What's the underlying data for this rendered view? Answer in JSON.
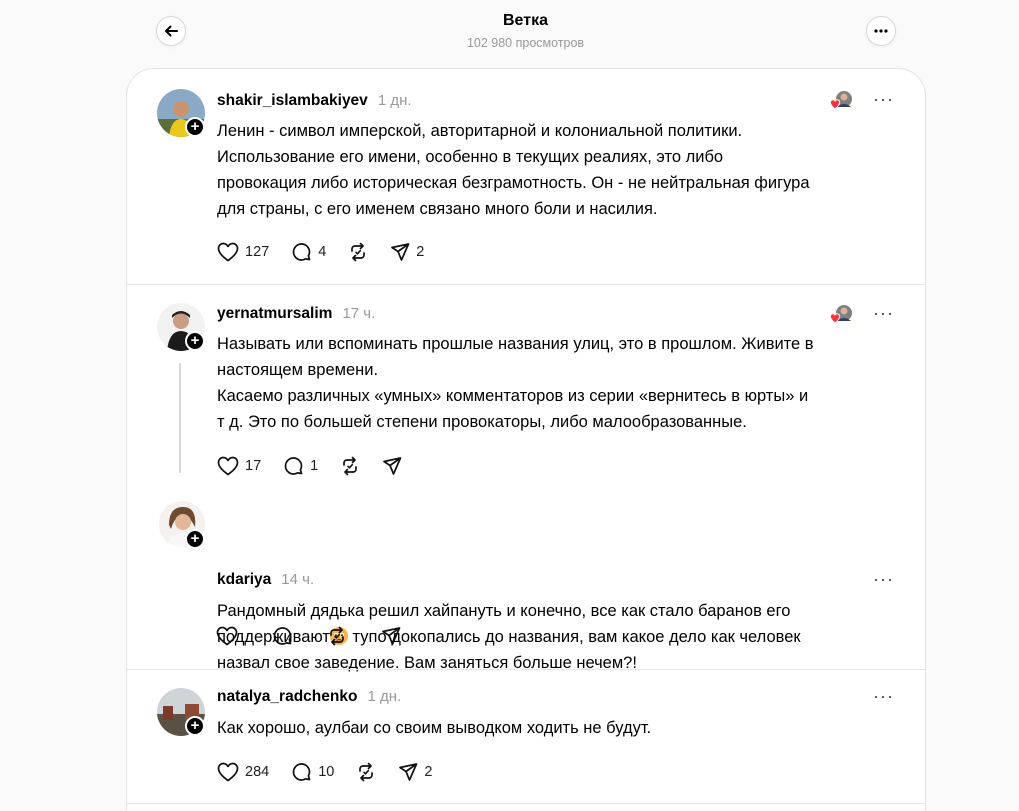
{
  "header": {
    "title": "Ветка",
    "views": "102 980 просмотров"
  },
  "colors": {
    "heart": "#ff3040",
    "accent": "#000000",
    "muted": "#999999"
  },
  "posts": [
    {
      "username": "shakir_islambakiyev",
      "time": "1 дн.",
      "lines": [
        "Ленин - символ имперской, авторитарной и колониальной политики.",
        "Использование его имени, особенно в текущих реалиях, это либо",
        "провокация либо историческая безграмотность. Он - не нейтральная фигура",
        "для страны, с его именем связано много боли и насилия."
      ],
      "likes": "127",
      "replies": "4",
      "shares": "2"
    },
    {
      "username": "yernatmursalim",
      "time": "17 ч.",
      "lines": [
        "Называть или вспоминать прошлые названия улиц, это в прошлом. Живите в",
        "настоящем времени.",
        "Касаемо различных «умных» комментаторов из серии «вернитесь в юрты» и",
        "т д. Это по большей степени провокаторы, либо малообразованные."
      ],
      "likes": "17",
      "replies": "1",
      "shares": ""
    },
    {
      "username": "kdariya",
      "time": "14 ч.",
      "line1": "Рандомный дядька решил хайпануть и конечно, все как стало баранов его",
      "line2a": "поддерживают",
      "line2b": " тупо докопались до названия, вам какое дело как человек",
      "line3": "назвал свое заведение. Вам заняться больше нечем?!",
      "likes": "",
      "replies": "",
      "shares": ""
    },
    {
      "username": "natalya_radchenko",
      "time": "1 дн.",
      "lines": [
        "Как хорошо, аулбаи со своим выводком ходить не будут."
      ],
      "likes": "284",
      "replies": "10",
      "shares": "2"
    }
  ],
  "icons": {
    "back": "arrow-left-icon",
    "more": "more-horizontal-icon",
    "like": "heart-icon",
    "reply": "comment-icon",
    "repost": "repost-icon",
    "share": "send-icon",
    "follow": "plus-icon"
  }
}
